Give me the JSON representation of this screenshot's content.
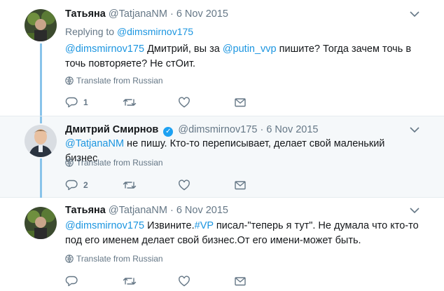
{
  "colors": {
    "accent": "#1da1f2",
    "link": "#1b95e0",
    "muted": "#657786",
    "thread_line": "#89c3ea"
  },
  "icons": [
    "chevron-down-icon",
    "globe-icon",
    "reply-icon",
    "retweet-icon",
    "like-icon",
    "message-icon",
    "verified-icon"
  ],
  "tweets": [
    {
      "name": "Татьяна",
      "handle": "@TatjanaNM",
      "dot": "·",
      "date": "6 Nov 2015",
      "replying_prefix": "Replying to ",
      "replying_to": "@dimsmirnov175",
      "mention": "@dimsmirnov175",
      "text_a": " Дмитрий, вы за ",
      "mention2": "@putin_vvp",
      "text_b": " пишите? Тогда зачем точь в точь повторяете? Не стОит.",
      "translate": "Translate from Russian",
      "reply_count": "1"
    },
    {
      "name": "Дмитрий Смирнов",
      "handle": "@dimsmirnov175",
      "dot": "·",
      "date": "6 Nov 2015",
      "mention": "@TatjanaNM",
      "text": " не пишу. Кто-то переписывает, делает свой маленький бизнес",
      "translate": "Translate from Russian",
      "reply_count": "2"
    },
    {
      "name": "Татьяна",
      "handle": "@TatjanaNM",
      "dot": "·",
      "date": "6 Nov 2015",
      "mention": "@dimsmirnov175",
      "text_a": " Извините.",
      "hashtag": "#VP",
      "text_b": " писал-\"теперь я тут\". Не думала что кто-то под его именем делает свой бизнес.От его имени-может быть.",
      "translate": "Translate from Russian"
    }
  ]
}
